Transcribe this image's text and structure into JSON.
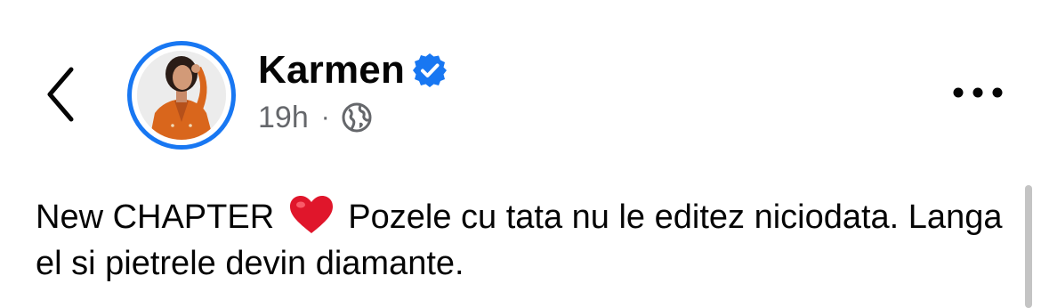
{
  "header": {
    "author_name": "Karmen",
    "timestamp": "19h",
    "separator": "·",
    "audience_icon": "globe-icon",
    "verified_icon": "verified-badge-icon",
    "back_icon": "chevron-left-icon",
    "more_icon": "more-horizontal-icon",
    "avatar_ring_color": "#1877f2"
  },
  "post": {
    "text_before_emoji": "New CHAPTER ",
    "emoji": "heart-emoji",
    "text_after_emoji": " Pozele cu tata nu le editez niciodata. Langa el si pietrele devin diamante."
  },
  "colors": {
    "accent": "#1877f2",
    "heart": "#e0162b",
    "secondary_text": "#65676b",
    "primary_text": "#050505"
  }
}
